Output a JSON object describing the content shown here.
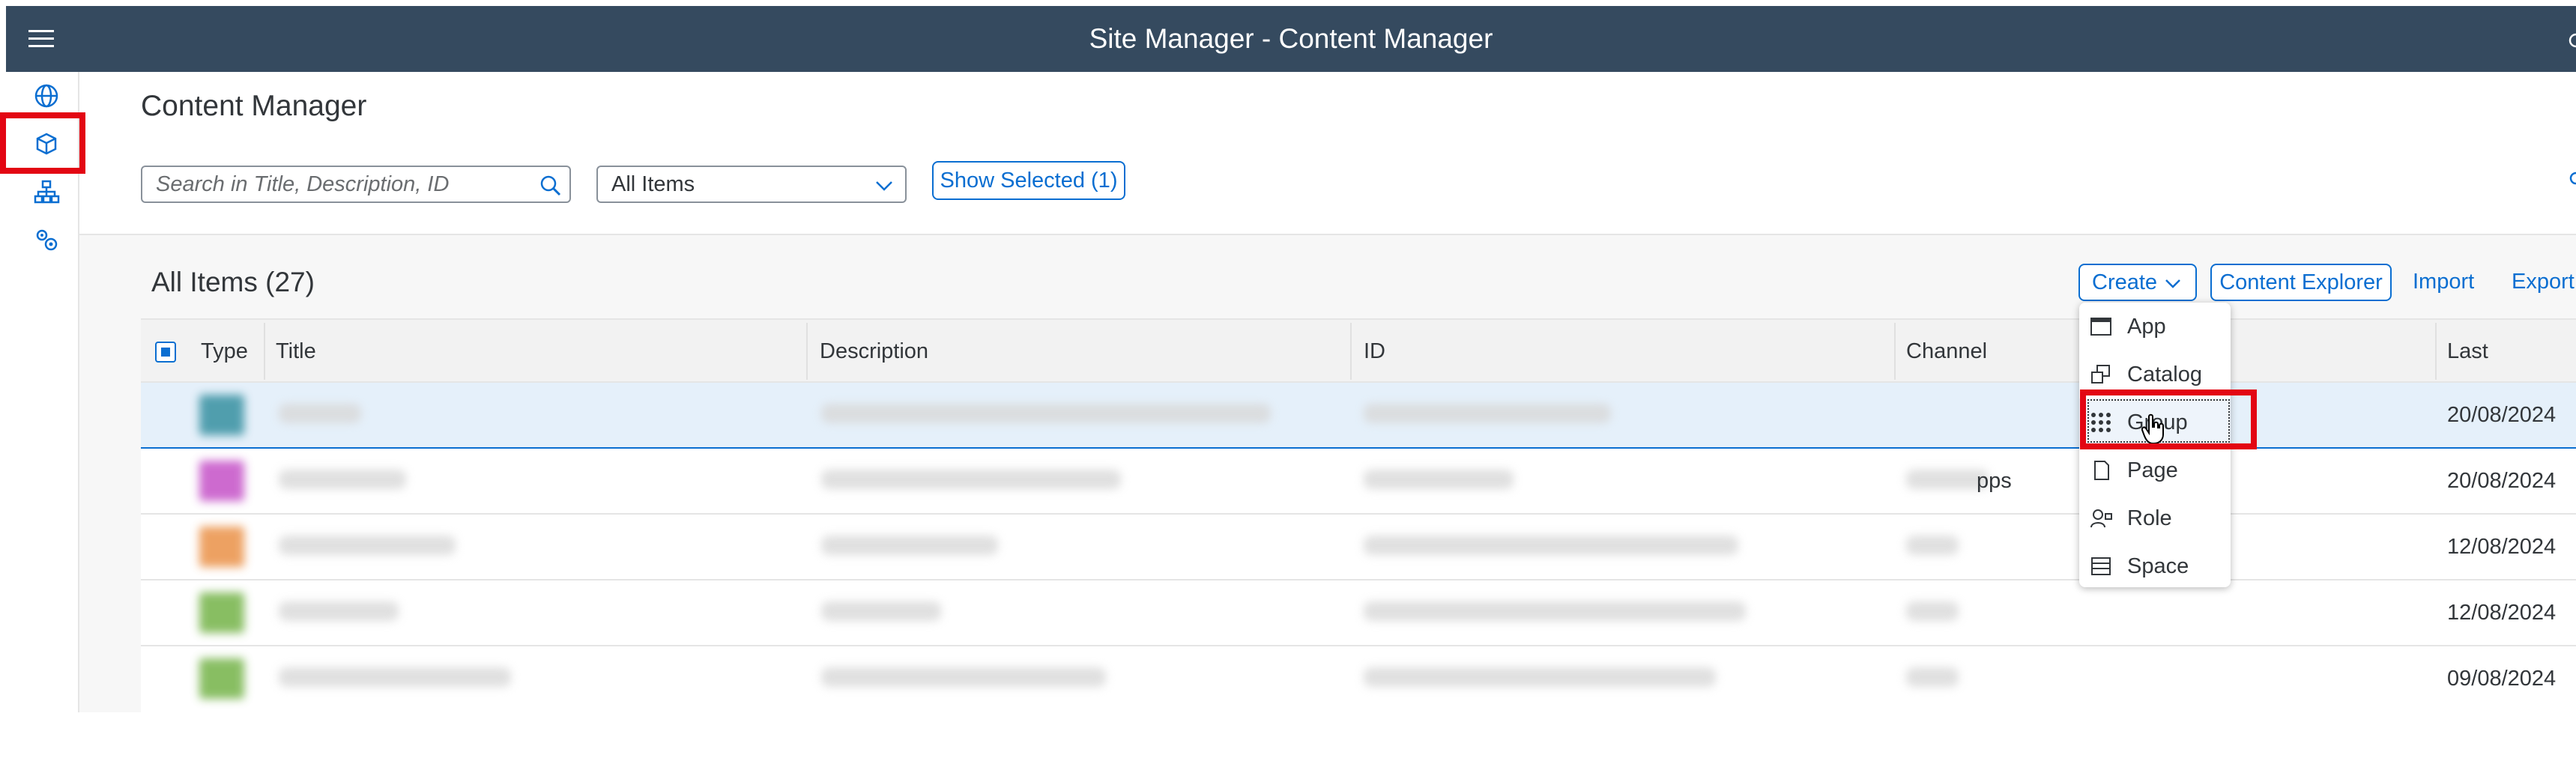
{
  "shell": {
    "title": "Site Manager - Content Manager",
    "menu_icon": "hamburger-icon"
  },
  "sidebar": {
    "items": [
      {
        "name": "globe-icon"
      },
      {
        "name": "content-cube-icon",
        "selected": true
      },
      {
        "name": "site-hierarchy-icon"
      },
      {
        "name": "settings-icon"
      }
    ]
  },
  "page": {
    "title": "Content Manager"
  },
  "filters": {
    "search_placeholder": "Search in Title, Description, ID",
    "select_value": "All Items",
    "show_selected_label": "Show Selected (1)"
  },
  "table": {
    "title": "All Items (27)",
    "toolbar": {
      "create_label": "Create",
      "explorer_label": "Content Explorer",
      "import_label": "Import",
      "export_label": "Export"
    },
    "columns": [
      "Type",
      "Title",
      "Description",
      "ID",
      "Channel",
      "Last Modified"
    ],
    "rows": [
      {
        "last_modified": "20/08/2024",
        "channel": "",
        "color": "#2c8a9b"
      },
      {
        "last_modified": "20/08/2024",
        "channel": "pps",
        "color": "#c146c4"
      },
      {
        "last_modified": "12/08/2024",
        "channel": "",
        "color": "#e98a3c"
      },
      {
        "last_modified": "12/08/2024",
        "channel": "",
        "color": "#6bae3c"
      },
      {
        "last_modified": "09/08/2024",
        "channel": "",
        "color": "#6bae3c"
      }
    ]
  },
  "create_menu": {
    "items": [
      {
        "label": "App",
        "icon": "app-window-icon"
      },
      {
        "label": "Catalog",
        "icon": "catalog-icon"
      },
      {
        "label": "Group",
        "icon": "group-grid-icon"
      },
      {
        "label": "Page",
        "icon": "page-icon"
      },
      {
        "label": "Role",
        "icon": "role-icon"
      },
      {
        "label": "Space",
        "icon": "space-icon"
      }
    ]
  },
  "colors": {
    "shell": "#354a5f",
    "accent": "#0a6ed1",
    "highlight": "#e30613",
    "selected_row": "#e5f0fa"
  }
}
